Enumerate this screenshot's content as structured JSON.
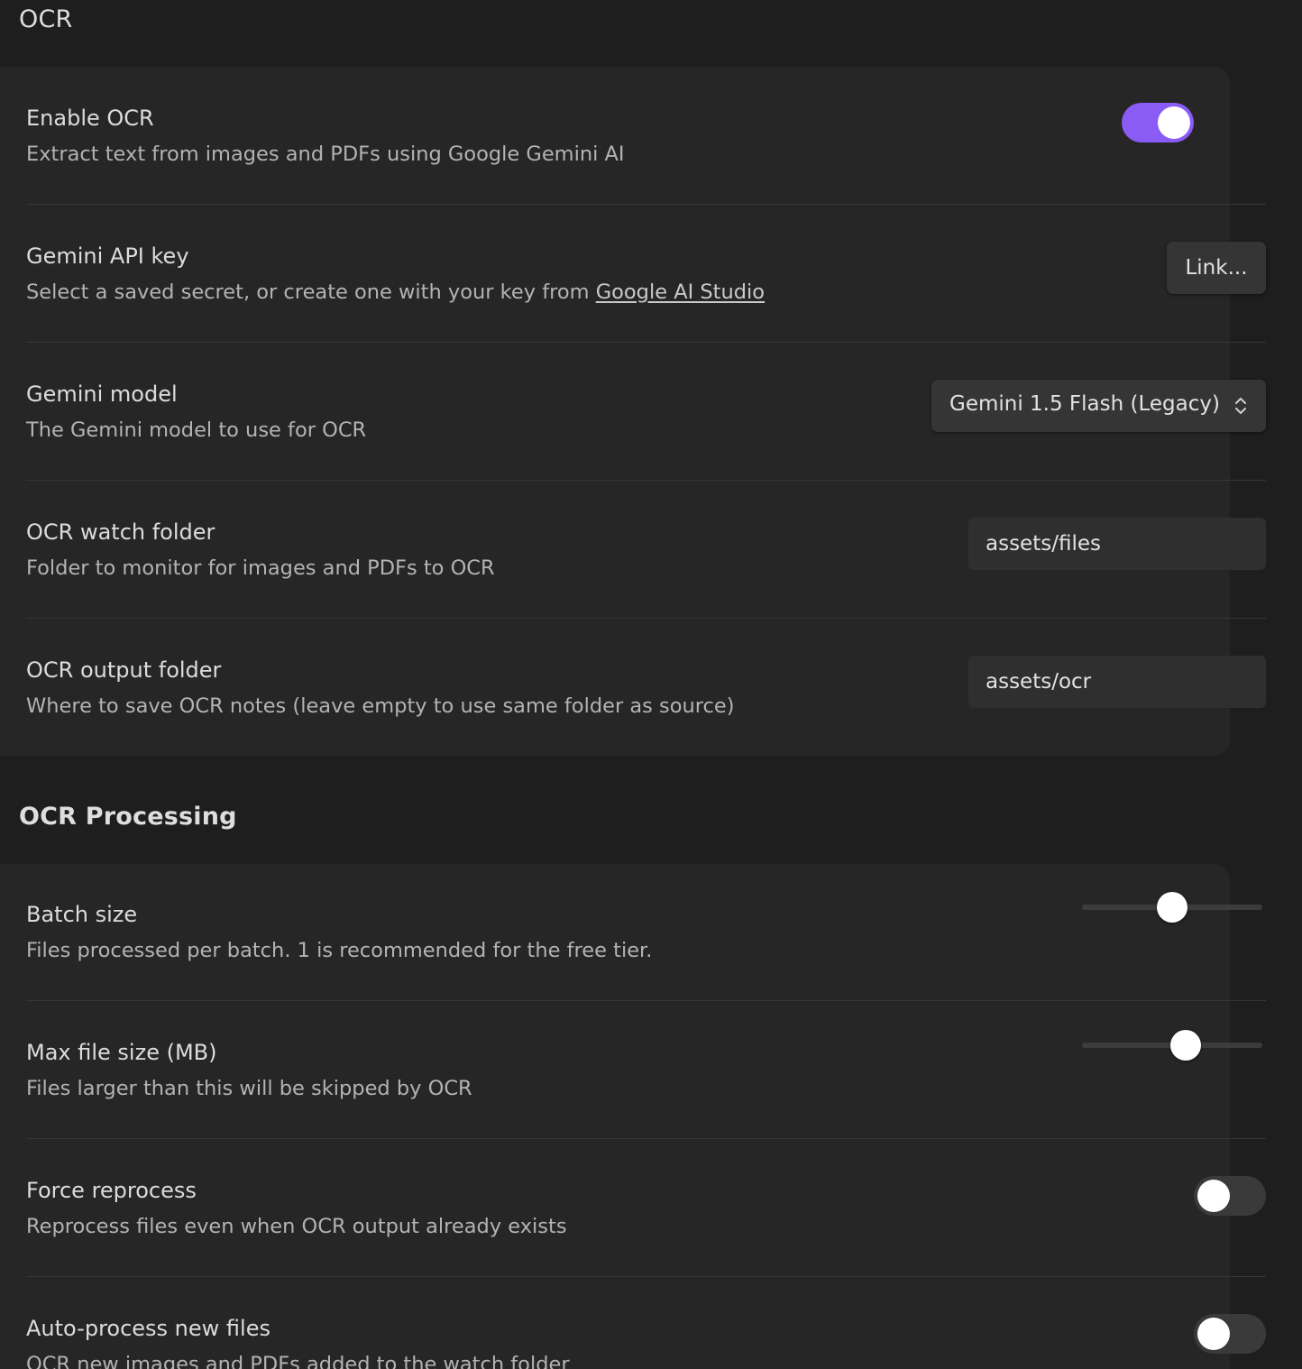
{
  "sections": {
    "ocr": {
      "heading": "OCR",
      "enable_ocr": {
        "label": "Enable OCR",
        "description": "Extract text from images and PDFs using Google Gemini AI",
        "enabled": true
      },
      "api_key": {
        "label": "Gemini API key",
        "description_prefix": "Select a saved secret, or create one with your key from ",
        "link_text": "Google AI Studio",
        "button_label": "Link..."
      },
      "model": {
        "label": "Gemini model",
        "description": "The Gemini model to use for OCR",
        "selected": "Gemini 1.5 Flash (Legacy)"
      },
      "watch_folder": {
        "label": "OCR watch folder",
        "description": "Folder to monitor for images and PDFs to OCR",
        "value": "assets/files"
      },
      "output_folder": {
        "label": "OCR output folder",
        "description": "Where to save OCR notes (leave empty to use same folder as source)",
        "value": "assets/ocr"
      }
    },
    "processing": {
      "heading": "OCR Processing",
      "batch_size": {
        "label": "Batch size",
        "description": "Files processed per batch. 1 is recommended for the free tier.",
        "slider_fraction": 0.5
      },
      "max_file_size": {
        "label": "Max file size (MB)",
        "description": "Files larger than this will be skipped by OCR",
        "slider_fraction": 0.575
      },
      "force_reprocess": {
        "label": "Force reprocess",
        "description": "Reprocess files even when OCR output already exists",
        "enabled": false
      },
      "auto_process": {
        "label": "Auto-process new files",
        "description": "OCR new images and PDFs added to the watch folder",
        "enabled": false
      }
    }
  },
  "colors": {
    "accent": "#8a5cf5",
    "background": "#1e1e1e",
    "card": "#262626"
  },
  "icons": {
    "select_chevron": "chevron-up-down-icon"
  }
}
